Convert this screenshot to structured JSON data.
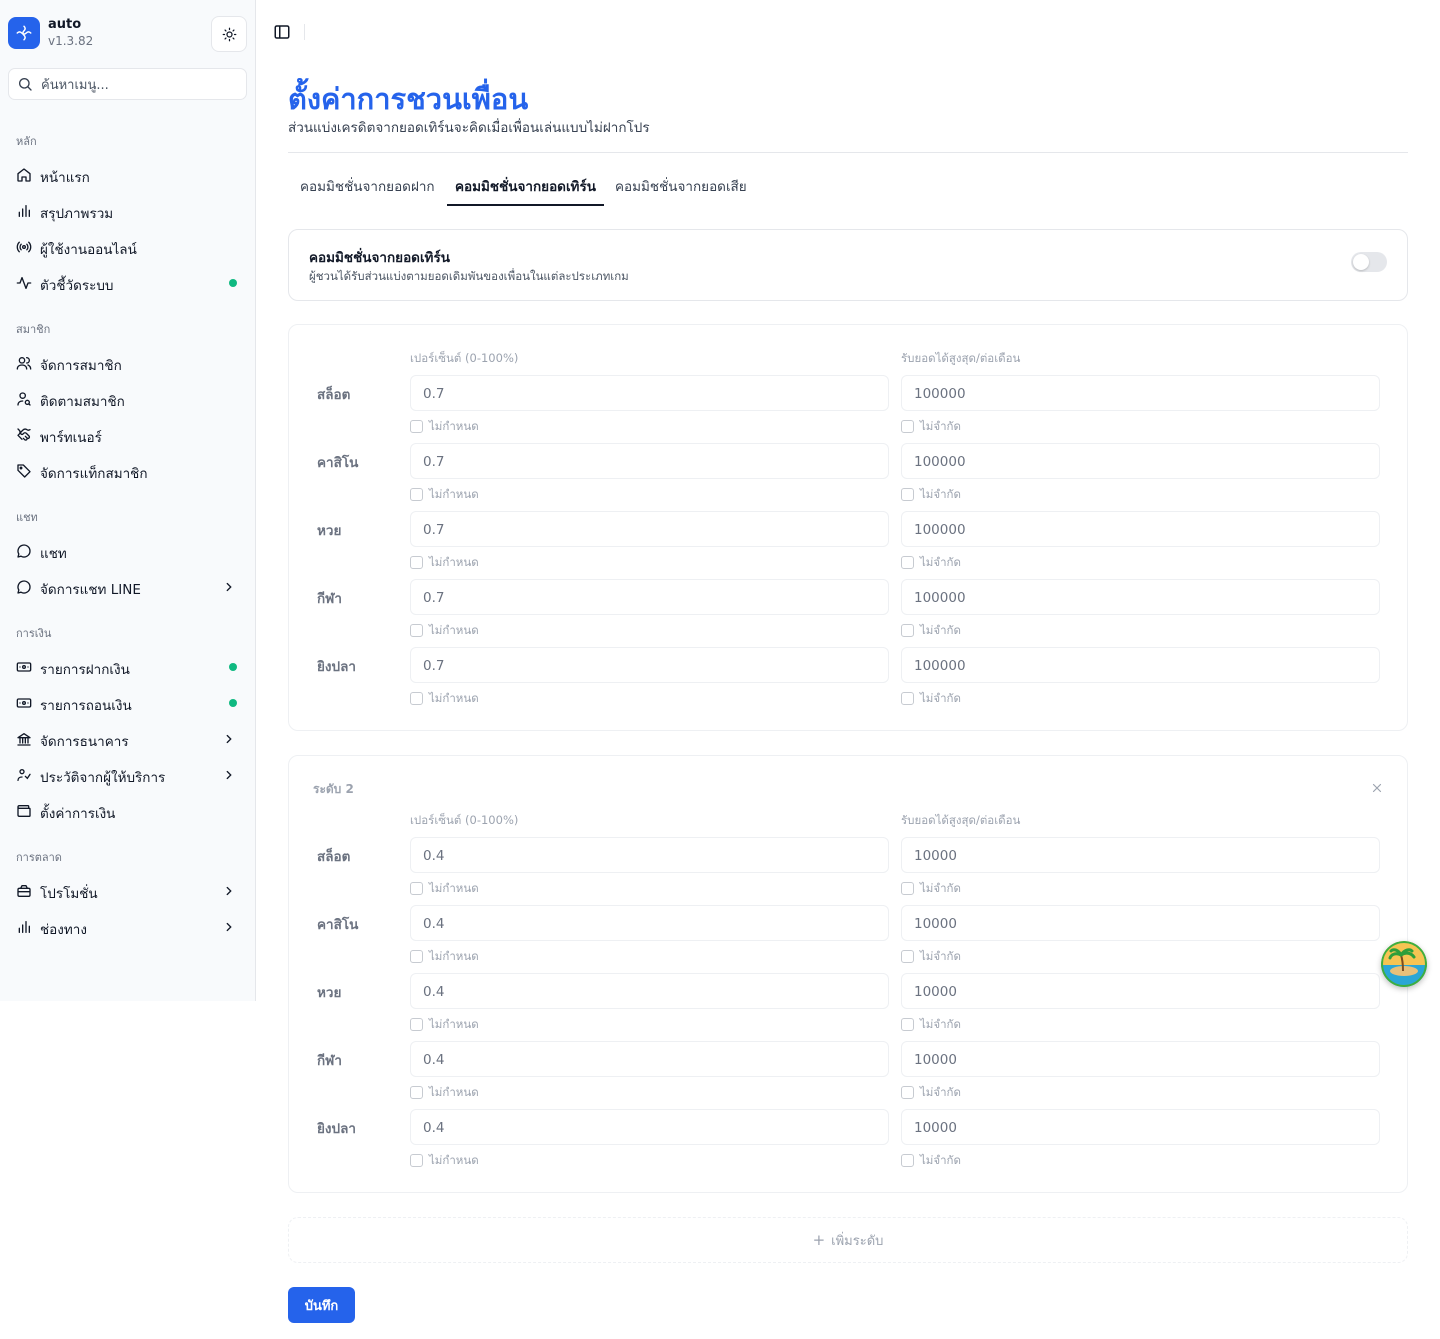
{
  "app": {
    "name": "auto",
    "version": "v1.3.82"
  },
  "search": {
    "placeholder": "ค้นหาเมนู..."
  },
  "sidebar": {
    "sections": [
      {
        "label": "หลัก",
        "items": [
          {
            "label": "หน้าแรก",
            "icon": "home-icon"
          },
          {
            "label": "สรุปภาพรวม",
            "icon": "bar-chart-icon"
          },
          {
            "label": "ผู้ใช้งานออนไลน์",
            "icon": "radio-icon"
          },
          {
            "label": "ตัวชี้วัดระบบ",
            "icon": "activity-icon",
            "dot": true
          }
        ]
      },
      {
        "label": "สมาชิก",
        "items": [
          {
            "label": "จัดการสมาชิก",
            "icon": "users-icon"
          },
          {
            "label": "ติดตามสมาชิก",
            "icon": "user-search-icon"
          },
          {
            "label": "พาร์ทเนอร์",
            "icon": "handshake-icon"
          },
          {
            "label": "จัดการแท็กสมาชิก",
            "icon": "tag-icon"
          }
        ]
      },
      {
        "label": "แชท",
        "items": [
          {
            "label": "แชท",
            "icon": "chat-icon"
          },
          {
            "label": "จัดการแชท LINE",
            "icon": "chat-icon",
            "chevron": true
          }
        ]
      },
      {
        "label": "การเงิน",
        "items": [
          {
            "label": "รายการฝากเงิน",
            "icon": "deposit-icon",
            "dot": true
          },
          {
            "label": "รายการถอนเงิน",
            "icon": "withdraw-icon",
            "dot": true
          },
          {
            "label": "จัดการธนาคาร",
            "icon": "bank-icon",
            "chevron": true
          },
          {
            "label": "ประวัติจากผู้ให้บริการ",
            "icon": "provider-icon",
            "chevron": true
          },
          {
            "label": "ตั้งค่าการเงิน",
            "icon": "wallet-icon"
          }
        ]
      },
      {
        "label": "การตลาด",
        "items": [
          {
            "label": "โปรโมชั่น",
            "icon": "promotion-icon",
            "chevron": true
          },
          {
            "label": "ช่องทาง",
            "icon": "bar-chart-icon",
            "chevron": true
          }
        ]
      }
    ]
  },
  "page": {
    "title": "ตั้งค่าการชวนเพื่อน",
    "subtitle": "ส่วนแบ่งเครดิตจากยอดเทิร์นจะคิดเมื่อเพื่อนเล่นแบบไม่ฝากโปร"
  },
  "tabs": [
    {
      "label": "คอมมิชชั่นจากยอดฝาก",
      "active": false
    },
    {
      "label": "คอมมิชชั่นจากยอดเทิร์น",
      "active": true
    },
    {
      "label": "คอมมิชชั่นจากยอดเสีย",
      "active": false
    }
  ],
  "toggle_card": {
    "title": "คอมมิชชั่นจากยอดเทิร์น",
    "description": "ผู้ชวนได้รับส่วนแบ่งตามยอดเดิมพันของเพื่อนในแต่ละประเภทเกม",
    "enabled": false
  },
  "columns": {
    "percent": "เปอร์เซ็นต์ (0-100%)",
    "max": "รับยอดได้สูงสุด/ต่อเดือน"
  },
  "checkbox_labels": {
    "percent": "ไม่กำหนด",
    "max": "ไม่จำกัด"
  },
  "levels": [
    {
      "title": "",
      "removable": false,
      "rows": [
        {
          "game": "สล็อต",
          "percent": "0.7",
          "max": "100000"
        },
        {
          "game": "คาสิโน",
          "percent": "0.7",
          "max": "100000"
        },
        {
          "game": "หวย",
          "percent": "0.7",
          "max": "100000"
        },
        {
          "game": "กีฬา",
          "percent": "0.7",
          "max": "100000"
        },
        {
          "game": "ยิงปลา",
          "percent": "0.7",
          "max": "100000"
        }
      ]
    },
    {
      "title": "ระดับ 2",
      "removable": true,
      "rows": [
        {
          "game": "สล็อต",
          "percent": "0.4",
          "max": "10000"
        },
        {
          "game": "คาสิโน",
          "percent": "0.4",
          "max": "10000"
        },
        {
          "game": "หวย",
          "percent": "0.4",
          "max": "10000"
        },
        {
          "game": "กีฬา",
          "percent": "0.4",
          "max": "10000"
        },
        {
          "game": "ยิงปลา",
          "percent": "0.4",
          "max": "10000"
        }
      ]
    }
  ],
  "actions": {
    "add_level": "เพิ่มระดับ",
    "save": "บันทึก"
  },
  "colors": {
    "accent": "#2563eb",
    "status_dot": "#10b981"
  }
}
